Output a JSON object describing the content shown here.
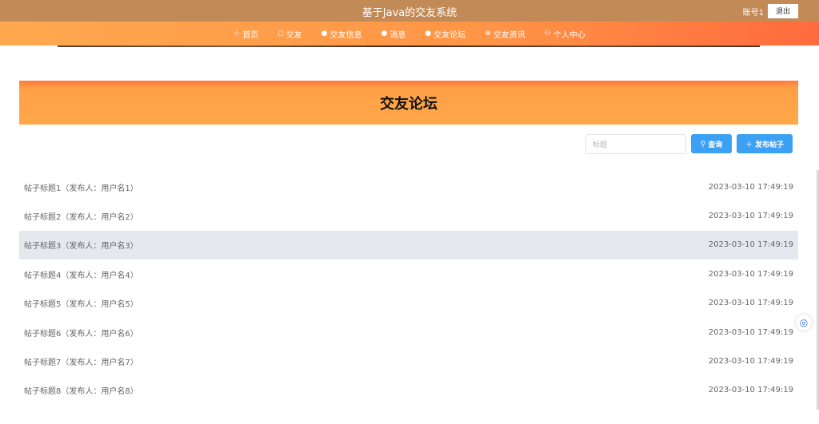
{
  "header": {
    "title": "基于Java的交友系统",
    "account": "账号1",
    "logout_label": "退出"
  },
  "nav": [
    {
      "label": "首页",
      "icon": "star-icon",
      "glyph": "☆"
    },
    {
      "label": "交友",
      "icon": "bag-icon",
      "glyph": "◻"
    },
    {
      "label": "交友信息",
      "icon": "info-icon",
      "glyph": "●"
    },
    {
      "label": "消息",
      "icon": "question-icon",
      "glyph": "●"
    },
    {
      "label": "交友论坛",
      "icon": "info-circle-icon",
      "glyph": "●"
    },
    {
      "label": "交友资讯",
      "icon": "globe-icon",
      "glyph": "⊕"
    },
    {
      "label": "个人中心",
      "icon": "user-icon",
      "glyph": "⚇"
    }
  ],
  "page": {
    "title": "交友论坛"
  },
  "search": {
    "placeholder": "标题",
    "query_label": "查询",
    "post_label": "发布帖子"
  },
  "posts": [
    {
      "title": "帖子标题1（发布人：用户名1）",
      "date": "2023-03-10 17:49:19"
    },
    {
      "title": "帖子标题2（发布人：用户名2）",
      "date": "2023-03-10 17:49:19"
    },
    {
      "title": "帖子标题3（发布人：用户名3）",
      "date": "2023-03-10 17:49:19"
    },
    {
      "title": "帖子标题4（发布人：用户名4）",
      "date": "2023-03-10 17:49:19"
    },
    {
      "title": "帖子标题5（发布人：用户名5）",
      "date": "2023-03-10 17:49:19"
    },
    {
      "title": "帖子标题6（发布人：用户名6）",
      "date": "2023-03-10 17:49:19"
    },
    {
      "title": "帖子标题7（发布人：用户名7）",
      "date": "2023-03-10 17:49:19"
    },
    {
      "title": "帖子标题8（发布人：用户名8）",
      "date": "2023-03-10 17:49:19"
    }
  ],
  "colors": {
    "topbar": "#c28a57",
    "nav_start": "#ffa94f",
    "nav_end": "#ff6a3d",
    "button_blue": "#3ca0f5",
    "active_row": "#e5e8ee"
  }
}
